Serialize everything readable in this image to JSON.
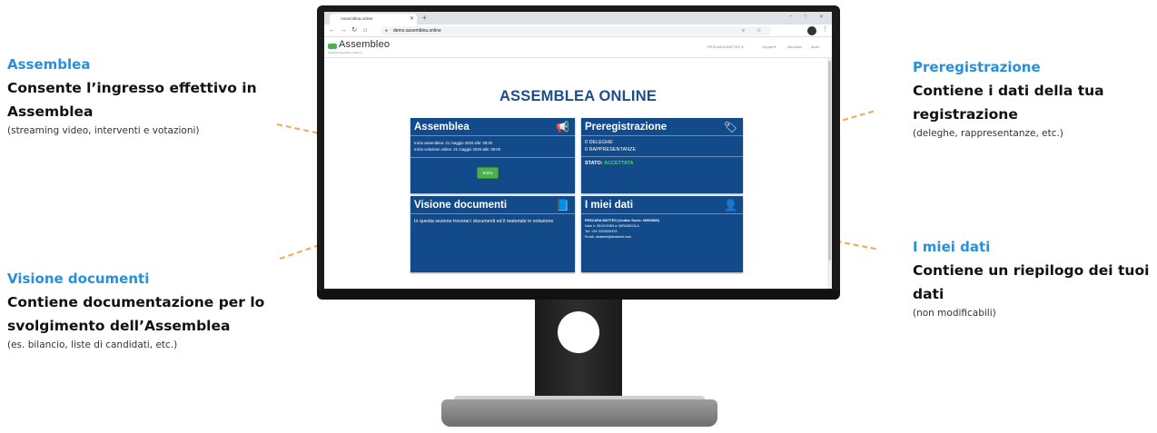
{
  "annotations": {
    "assemblea": {
      "title": "Assemblea",
      "heading_line1": "Consente l’ingresso effettivo in",
      "heading_line2": "Assemblea",
      "sub": "(streaming video, interventi e votazioni)"
    },
    "visione": {
      "title": "Visione documenti",
      "heading_line1": "Contiene documentazione per lo",
      "heading_line2": "svolgimento dell’Assemblea",
      "sub": "(es. bilancio, liste di candidati, etc.)"
    },
    "preregistrazione": {
      "title": "Preregistrazione",
      "heading_line1": "Contiene i dati della tua",
      "heading_line2": "registrazione",
      "sub": "(deleghe, rappresentanze, etc.)"
    },
    "miei_dati": {
      "title": "I miei dati",
      "heading_line1": "Contiene un riepilogo dei tuoi",
      "heading_line2": "dati",
      "sub": "(non modificabili)"
    }
  },
  "browser": {
    "tab_title": "Assemblea.online",
    "url": "demo.assemblea.online"
  },
  "site": {
    "logo": "Assembleo",
    "logo_sub": "Segreteria Assemblea e Votazioni",
    "nav_user": "PESCARA MATTEO ▾",
    "nav_lang": "Lingua ▾",
    "nav_settings": "Istruzioni",
    "nav_help": "Aiuto",
    "page_title": "ASSEMBLEA ONLINE"
  },
  "cards": {
    "assemblea": {
      "title": "Assemblea",
      "line1": "Inizio assemblea: 21 maggio 2020 alle: 09:00",
      "line2": "Inizio votazioni online: 21 maggio 2020 alle: 09:00",
      "button": "Entra"
    },
    "preregistrazione": {
      "title": "Preregistrazione",
      "deleghe": "0 DELEGHE",
      "rappresentanze": "0 RAPPRESENTANZE",
      "stato_label": "STATO:",
      "stato_value": "ACCETTATA"
    },
    "visione": {
      "title": "Visione documenti",
      "text": "In questa sezione troverai i documenti ed il materiale in votazione"
    },
    "miei_dati": {
      "title": "I miei dati",
      "line1": "PESCARA MATTEO (Codice Socio: 0000DBH)",
      "line2": "Nato il: 26/10/1983 a: MIRANDOLA",
      "line3": "Tel: +39 3333333333",
      "line4": "Email: abdanet@abdanet.com"
    }
  },
  "colors": {
    "accent_blue": "#2a8fd9",
    "card_blue": "#124a8a",
    "dash_orange": "#f2a65a",
    "status_green": "#4cd65a"
  }
}
